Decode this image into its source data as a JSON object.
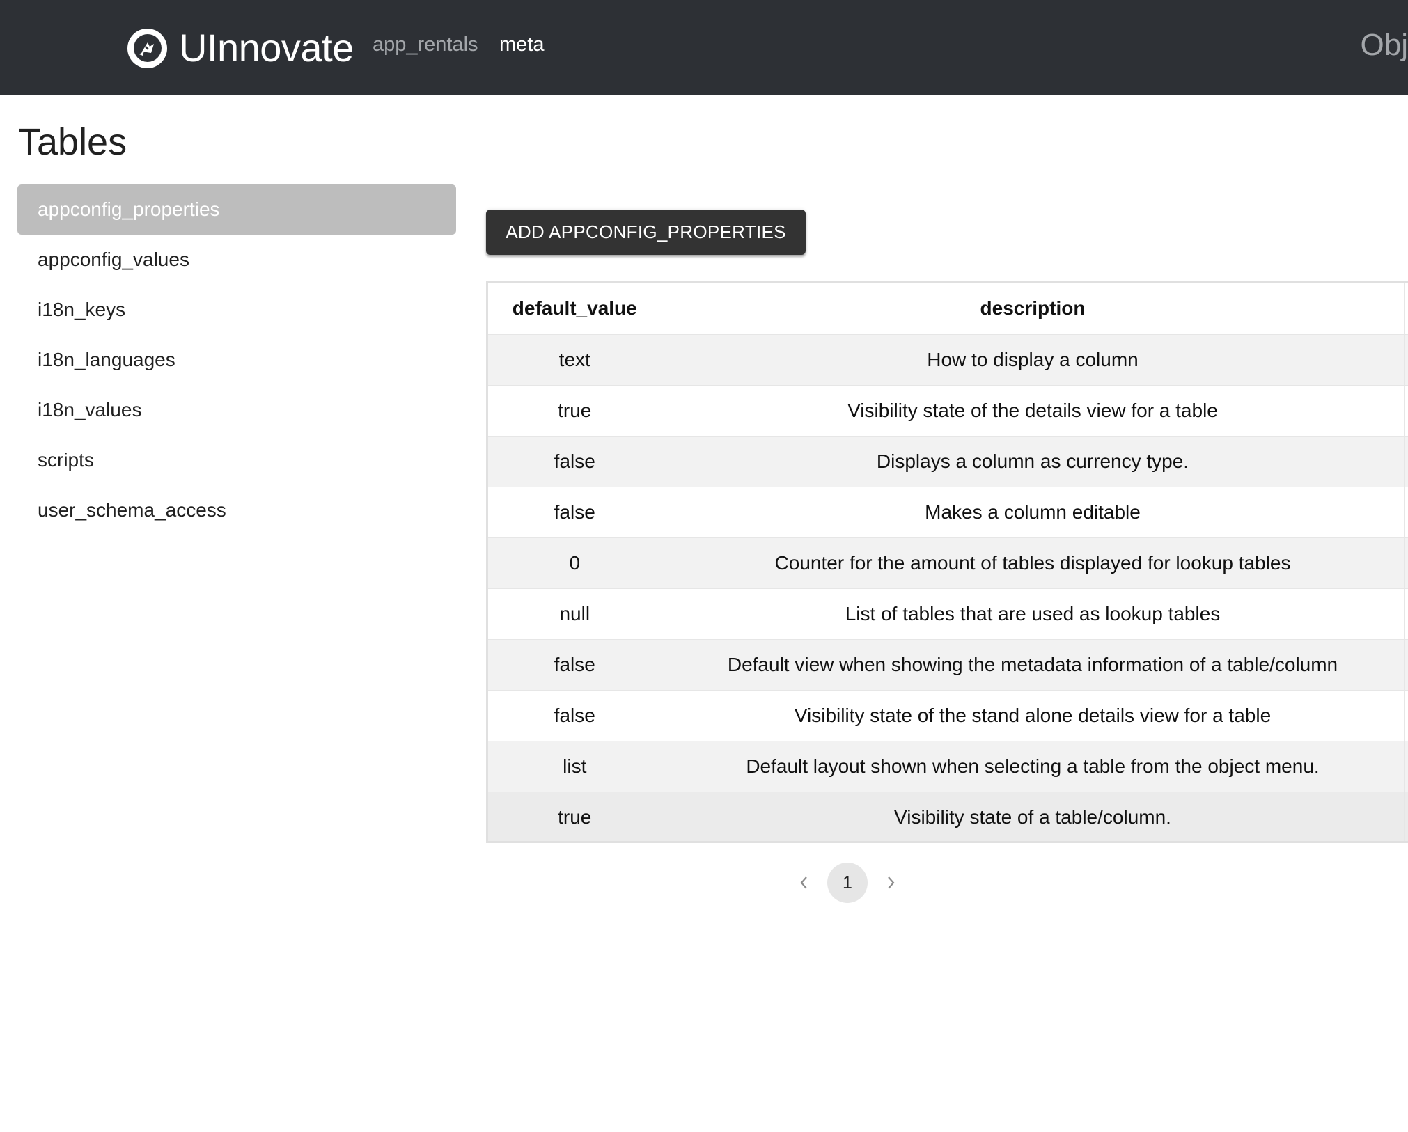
{
  "navbar": {
    "brand_name": "UInnovate",
    "links": [
      {
        "label": "app_rentals",
        "active": false
      },
      {
        "label": "meta",
        "active": true
      }
    ],
    "right_text": "Obj"
  },
  "sidebar": {
    "title": "Tables",
    "items": [
      {
        "label": "appconfig_properties",
        "selected": true
      },
      {
        "label": "appconfig_values",
        "selected": false
      },
      {
        "label": "i18n_keys",
        "selected": false
      },
      {
        "label": "i18n_languages",
        "selected": false
      },
      {
        "label": "i18n_values",
        "selected": false
      },
      {
        "label": "scripts",
        "selected": false
      },
      {
        "label": "user_schema_access",
        "selected": false
      }
    ]
  },
  "main": {
    "add_button_label": "ADD APPCONFIG_PROPERTIES",
    "table": {
      "columns": [
        "default_value",
        "description"
      ],
      "rows": [
        [
          "text",
          "How to display a column"
        ],
        [
          "true",
          "Visibility state of the details view for a table"
        ],
        [
          "false",
          "Displays a column as currency type."
        ],
        [
          "false",
          "Makes a column editable"
        ],
        [
          "0",
          "Counter for the amount of tables displayed for lookup tables"
        ],
        [
          "null",
          "List of tables that are used as lookup tables"
        ],
        [
          "false",
          "Default view when showing the metadata information of a table/column"
        ],
        [
          "false",
          "Visibility state of the stand alone details view for a table"
        ],
        [
          "list",
          "Default layout shown when selecting a table from the object menu."
        ],
        [
          "true",
          "Visibility state of a table/column."
        ]
      ]
    },
    "pagination": {
      "current_page": "1",
      "prev_icon": "chevron-left-icon",
      "next_icon": "chevron-right-icon"
    }
  },
  "colors": {
    "navbar_bg": "#2d3035",
    "selected_item_bg": "#bdbdbd",
    "button_bg": "#333333",
    "row_stripe": "#f2f2f2"
  }
}
